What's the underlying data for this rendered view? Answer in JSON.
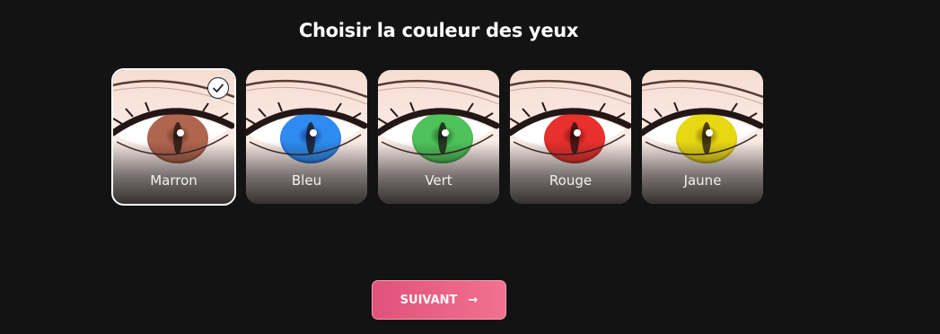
{
  "page": {
    "title": "Choisir la couleur des yeux"
  },
  "options": [
    {
      "label": "Marron",
      "iris": "#b0654f",
      "iris_dark": "#5a2a1e",
      "selected": true
    },
    {
      "label": "Bleu",
      "iris": "#2f8bf0",
      "iris_dark": "#0c2f8a",
      "selected": false
    },
    {
      "label": "Vert",
      "iris": "#4fc25a",
      "iris_dark": "#145a1d",
      "selected": false
    },
    {
      "label": "Rouge",
      "iris": "#e8302c",
      "iris_dark": "#7a0a0a",
      "selected": false
    },
    {
      "label": "Jaune",
      "iris": "#e8d814",
      "iris_dark": "#6e5f00",
      "selected": false
    }
  ],
  "icons": {
    "selected": "check-icon",
    "next": "arrow-right-icon"
  },
  "next_button": {
    "label": "SUIVANT",
    "arrow": "→"
  },
  "colors": {
    "accent_start": "#e0527b",
    "accent_end": "#f1728f",
    "background": "#141314"
  }
}
